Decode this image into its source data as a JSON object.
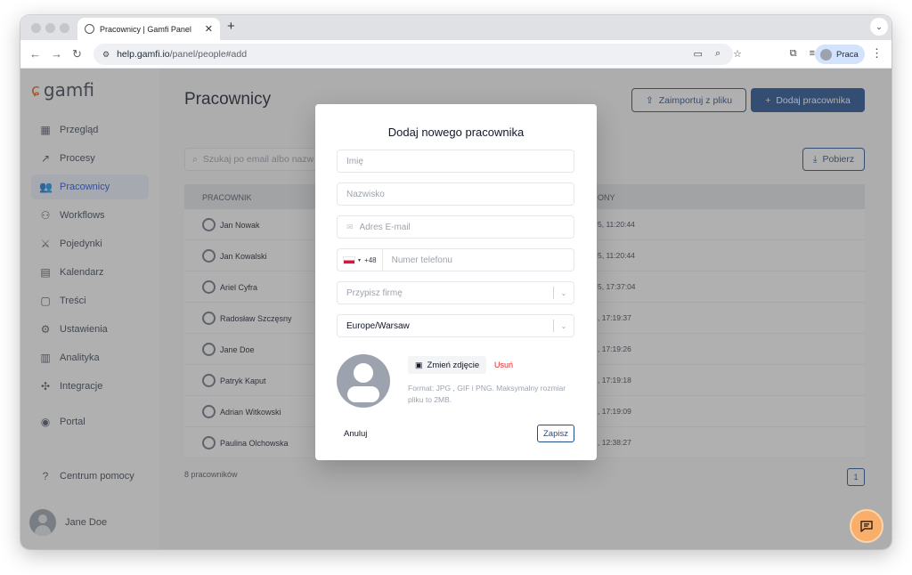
{
  "browser": {
    "tab_title": "Pracownicy | Gamfi Panel",
    "url_host": "help.gamfi.io",
    "url_path": "/panel/people#add",
    "profile_label": "Praca"
  },
  "app": {
    "logo_text": "gamfi",
    "nav": [
      {
        "label": "Przegląd",
        "icon": "dashboard-icon"
      },
      {
        "label": "Procesy",
        "icon": "process-icon"
      },
      {
        "label": "Pracownicy",
        "icon": "people-icon",
        "active": true
      },
      {
        "label": "Workflows",
        "icon": "workflow-icon"
      },
      {
        "label": "Pojedynki",
        "icon": "swords-icon"
      },
      {
        "label": "Kalendarz",
        "icon": "calendar-icon"
      },
      {
        "label": "Treści",
        "icon": "clipboard-icon"
      },
      {
        "label": "Ustawienia",
        "icon": "gear-icon"
      },
      {
        "label": "Analityka",
        "icon": "analytics-icon"
      },
      {
        "label": "Integracje",
        "icon": "puzzle-icon"
      },
      {
        "label": "Portal",
        "icon": "user-circle-icon"
      }
    ],
    "help_label": "Centrum pomocy",
    "user_name": "Jane Doe"
  },
  "page": {
    "title": "Pracownicy",
    "import_label": "Zaimportuj z pliku",
    "add_label": "Dodaj pracownika",
    "search_placeholder": "Szukaj po email albo nazw",
    "download_label": "Pobierz",
    "table": {
      "columns": [
        "PRACOWNIK",
        "ONY"
      ],
      "rows": [
        {
          "name": "Jan Nowak",
          "date": "5, 11:20:44"
        },
        {
          "name": "Jan Kowalski",
          "date": "5, 11:20:44"
        },
        {
          "name": "Ariel Cyfra",
          "date": "5, 17:37:04"
        },
        {
          "name": "Radosław Szczęsny",
          "date": ", 17:19:37"
        },
        {
          "name": "Jane Doe",
          "date": ", 17:19:26"
        },
        {
          "name": "Patryk Kaput",
          "date": ", 17:19:18"
        },
        {
          "name": "Adrian Witkowski",
          "date": ", 17:19:09"
        },
        {
          "name": "Paulina Olchowska",
          "date": ", 12:38:27"
        }
      ]
    },
    "count_label": "8 pracowników",
    "page_number": "1"
  },
  "modal": {
    "title": "Dodaj nowego pracownika",
    "first_name_placeholder": "Imię",
    "last_name_placeholder": "Nazwisko",
    "email_placeholder": "Adres E-mail",
    "phone_code": "+48",
    "phone_placeholder": "Numer telefonu",
    "company_placeholder": "Przypisz firmę",
    "timezone_value": "Europe/Warsaw",
    "change_photo_label": "Zmień zdjęcie",
    "remove_photo_label": "Usuń",
    "photo_hint": "Format: JPG , GIF i PNG. Maksymalny rozmiar pliku to 2MB.",
    "cancel_label": "Anuluj",
    "save_label": "Zapisz"
  },
  "colors": {
    "primary": "#1e4c8f",
    "brand": "#e85d1a",
    "danger": "#dc2626",
    "chat_fab": "#f9ae6b"
  }
}
